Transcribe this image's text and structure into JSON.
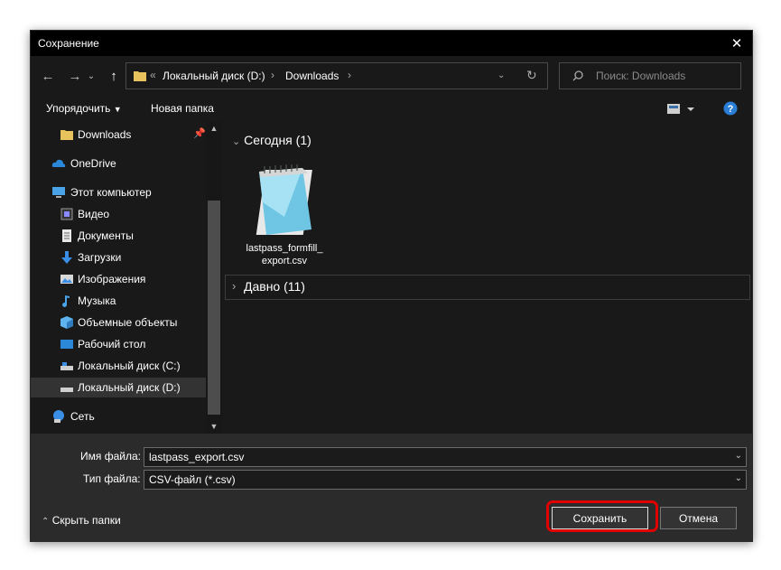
{
  "window": {
    "title": "Сохранение",
    "close_icon": "close-icon"
  },
  "nav": {
    "back_icon": "arrow-left-icon",
    "forward_icon": "arrow-right-icon",
    "up_icon": "arrow-up-icon",
    "address": {
      "overflow": "«",
      "segments": [
        "Локальный диск (D:)",
        "Downloads"
      ]
    },
    "search_placeholder": "Поиск: Downloads"
  },
  "toolbar": {
    "organize_label": "Упорядочить",
    "new_folder_label": "Новая папка"
  },
  "sidebar": {
    "items": [
      {
        "label": "Downloads",
        "icon": "folder-icon"
      },
      {
        "label": "OneDrive",
        "icon": "cloud-icon"
      },
      {
        "label": "Этот компьютер",
        "icon": "computer-icon"
      },
      {
        "label": "Видео",
        "icon": "video-icon"
      },
      {
        "label": "Документы",
        "icon": "document-icon"
      },
      {
        "label": "Загрузки",
        "icon": "download-icon"
      },
      {
        "label": "Изображения",
        "icon": "image-icon"
      },
      {
        "label": "Музыка",
        "icon": "music-icon"
      },
      {
        "label": "Объемные объекты",
        "icon": "cube-icon"
      },
      {
        "label": "Рабочий стол",
        "icon": "desktop-icon"
      },
      {
        "label": "Локальный диск (C:)",
        "icon": "drive-icon"
      },
      {
        "label": "Локальный диск (D:)",
        "icon": "drive-icon",
        "selected": true
      },
      {
        "label": "Сеть",
        "icon": "network-icon"
      }
    ]
  },
  "content": {
    "groups": [
      {
        "label": "Сегодня (1)",
        "expanded": true
      },
      {
        "label": "Давно (11)",
        "expanded": false
      }
    ],
    "files": [
      {
        "name_line1": "lastpass_formfill_",
        "name_line2": "export.csv",
        "icon": "notepad-icon"
      }
    ]
  },
  "form": {
    "filename_label": "Имя файла:",
    "filename_value": "lastpass_export.csv",
    "filetype_label": "Тип файла:",
    "filetype_value": "CSV-файл (*.csv)"
  },
  "footer": {
    "hide_folders_label": "Скрыть папки",
    "save_label": "Сохранить",
    "cancel_label": "Отмена"
  },
  "colors": {
    "highlight": "#e00000",
    "background": "#191919",
    "footer": "#2b2b2b",
    "accent": "#2a7ed6"
  }
}
